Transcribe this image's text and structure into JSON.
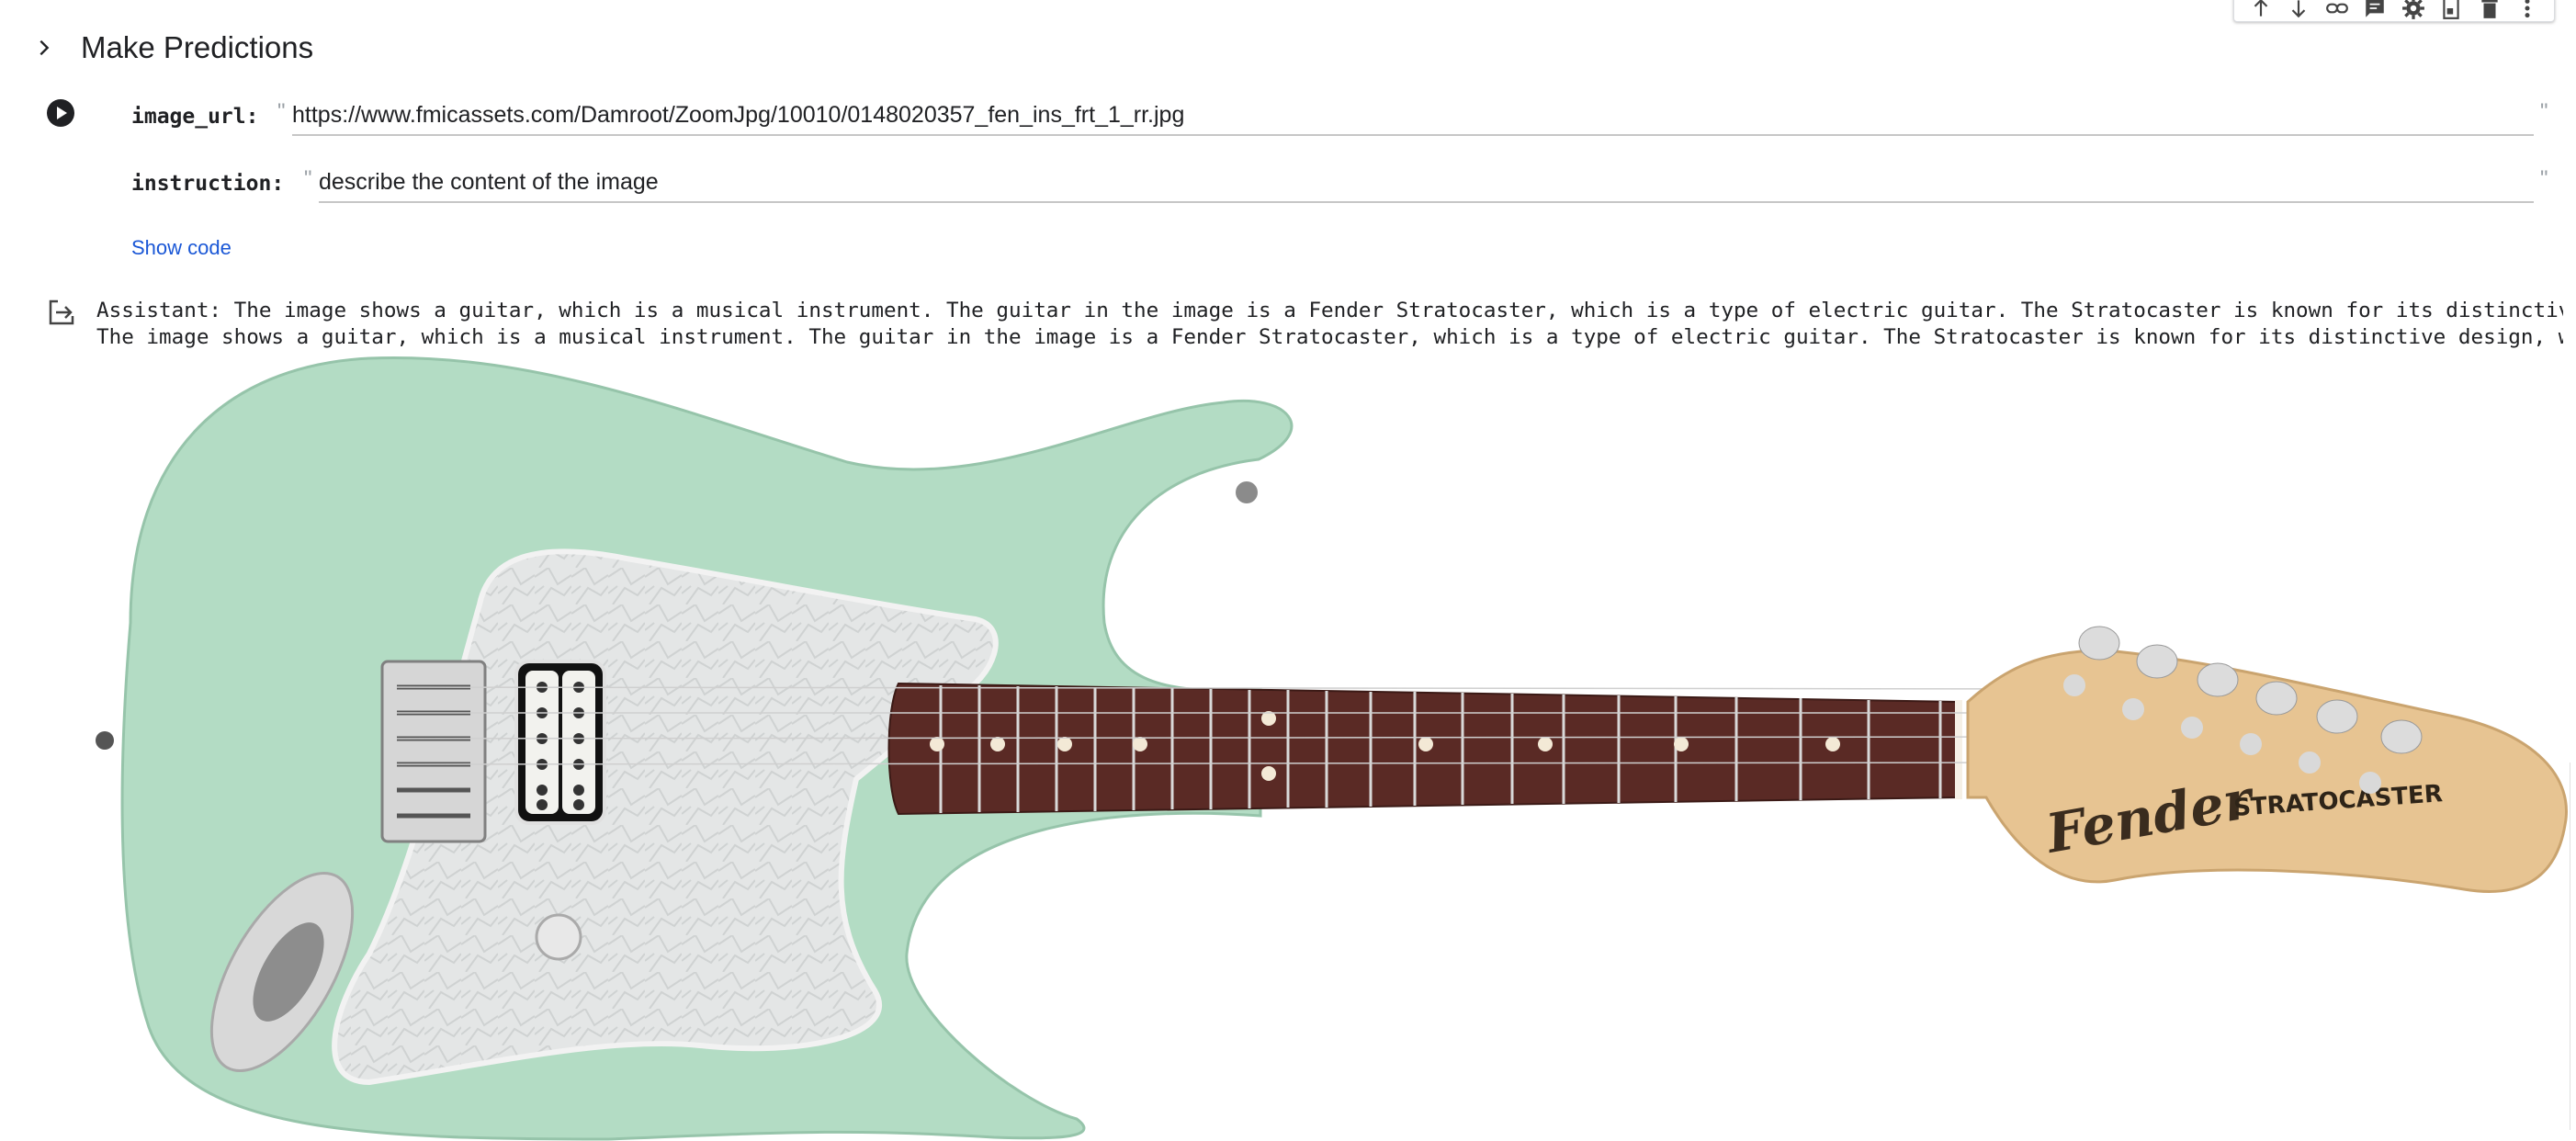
{
  "toolbar": {
    "items": [
      {
        "icon": "arrow-up-icon"
      },
      {
        "icon": "arrow-down-icon"
      },
      {
        "icon": "link-icon"
      },
      {
        "icon": "comment-icon"
      },
      {
        "icon": "gear-icon"
      },
      {
        "icon": "mirror-cell-icon"
      },
      {
        "icon": "delete-icon"
      },
      {
        "icon": "more-vert-icon"
      }
    ]
  },
  "section": {
    "title": "Make Predictions"
  },
  "form": {
    "image_url": {
      "label": "image_url:",
      "value": "https://www.fmicassets.com/Damroot/ZoomJpg/10010/0148020357_fen_ins_frt_1_rr.jpg"
    },
    "instruction": {
      "label": "instruction:",
      "value": "describe the content of the image"
    },
    "show_code": "Show code"
  },
  "output": {
    "line1": "Assistant: The image shows a guitar, which is a musical instrument. The guitar in the image is a Fender Stratocaster, which is a type of electric guitar. The Stratocaster is known for its distinctive",
    "line2": "The image shows a guitar, which is a musical instrument. The guitar in the image is a Fender Stratocaster, which is a type of electric guitar. The Stratocaster is known for its distinctive design, wh",
    "image": {
      "brand_text": "Fender",
      "model_text": "STRATOCASTER",
      "colors": {
        "body": "#b3dcc4",
        "pickguard": "#e4e6e6",
        "fretboard": "#5a2a25",
        "headstock": "#e7c492"
      }
    }
  }
}
